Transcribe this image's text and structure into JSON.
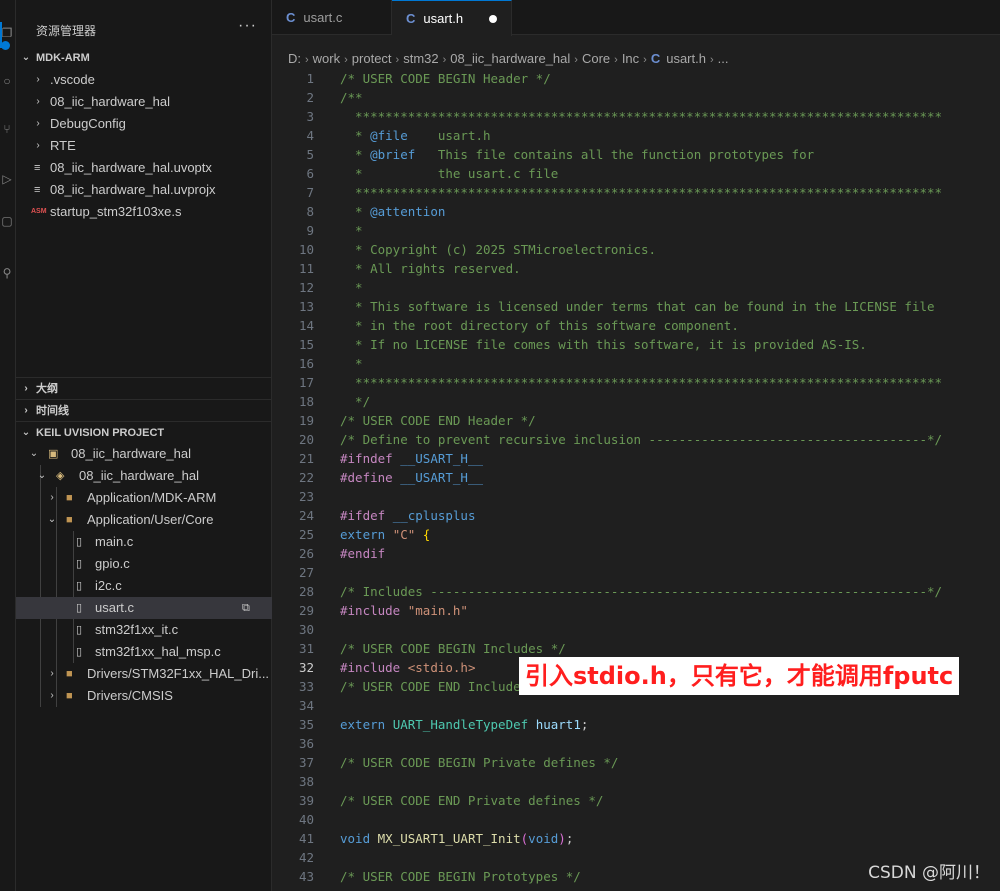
{
  "sidebar": {
    "title": "资源管理器",
    "more": "···",
    "mdk_section": "MDK-ARM",
    "mdk_items": [
      {
        "label": ".vscode",
        "kind": "folder"
      },
      {
        "label": "08_iic_hardware_hal",
        "kind": "folder"
      },
      {
        "label": "DebugConfig",
        "kind": "folder"
      },
      {
        "label": "RTE",
        "kind": "folder"
      },
      {
        "label": "08_iic_hardware_hal.uvoptx",
        "kind": "file"
      },
      {
        "label": "08_iic_hardware_hal.uvprojx",
        "kind": "file"
      },
      {
        "label": "startup_stm32f103xe.s",
        "kind": "asm"
      }
    ],
    "outline_section": "大纲",
    "timeline_section": "时间线",
    "keil_section": "KEIL UVISION PROJECT",
    "keil_items": [
      {
        "label": "08_iic_hardware_hal"
      },
      {
        "label": "08_iic_hardware_hal"
      },
      {
        "label": "Application/MDK-ARM"
      },
      {
        "label": "Application/User/Core"
      },
      {
        "label": "main.c"
      },
      {
        "label": "gpio.c"
      },
      {
        "label": "i2c.c"
      },
      {
        "label": "usart.c"
      },
      {
        "label": "stm32f1xx_it.c"
      },
      {
        "label": "stm32f1xx_hal_msp.c"
      },
      {
        "label": "Drivers/STM32F1xx_HAL_Dri..."
      },
      {
        "label": "Drivers/CMSIS"
      }
    ]
  },
  "tabs": [
    {
      "icon": "C",
      "label": "usart.c"
    },
    {
      "icon": "C",
      "label": "usart.h"
    }
  ],
  "breadcrumb": {
    "parts": [
      "D:",
      "work",
      "protect",
      "stm32",
      "08_iic_hardware_hal",
      "Core",
      "Inc"
    ],
    "file_icon": "C",
    "file": "usart.h",
    "tail": "..."
  },
  "editor": {
    "current_line": 32,
    "lines": [
      {
        "n": "1",
        "tokens": [
          [
            "cm",
            "/* USER CODE BEGIN Header */"
          ]
        ]
      },
      {
        "n": "2",
        "tokens": [
          [
            "cm",
            "/**"
          ]
        ]
      },
      {
        "n": "3",
        "tokens": [
          [
            "cm",
            "  ******************************************************************************"
          ]
        ]
      },
      {
        "n": "4",
        "tokens": [
          [
            "cm",
            "  * "
          ],
          [
            "doc",
            "@file"
          ],
          [
            "cm",
            "    usart.h"
          ]
        ]
      },
      {
        "n": "5",
        "tokens": [
          [
            "cm",
            "  * "
          ],
          [
            "doc",
            "@brief"
          ],
          [
            "cm",
            "   This file contains all the function prototypes for"
          ]
        ]
      },
      {
        "n": "6",
        "tokens": [
          [
            "cm",
            "  *          the usart.c file"
          ]
        ]
      },
      {
        "n": "7",
        "tokens": [
          [
            "cm",
            "  ******************************************************************************"
          ]
        ]
      },
      {
        "n": "8",
        "tokens": [
          [
            "cm",
            "  * "
          ],
          [
            "doc",
            "@attention"
          ]
        ]
      },
      {
        "n": "9",
        "tokens": [
          [
            "cm",
            "  *"
          ]
        ]
      },
      {
        "n": "10",
        "tokens": [
          [
            "cm",
            "  * Copyright (c) 2025 STMicroelectronics."
          ]
        ]
      },
      {
        "n": "11",
        "tokens": [
          [
            "cm",
            "  * All rights reserved."
          ]
        ]
      },
      {
        "n": "12",
        "tokens": [
          [
            "cm",
            "  *"
          ]
        ]
      },
      {
        "n": "13",
        "tokens": [
          [
            "cm",
            "  * This software is licensed under terms that can be found in the LICENSE file"
          ]
        ]
      },
      {
        "n": "14",
        "tokens": [
          [
            "cm",
            "  * in the root directory of this software component."
          ]
        ]
      },
      {
        "n": "15",
        "tokens": [
          [
            "cm",
            "  * If no LICENSE file comes with this software, it is provided AS-IS."
          ]
        ]
      },
      {
        "n": "16",
        "tokens": [
          [
            "cm",
            "  *"
          ]
        ]
      },
      {
        "n": "17",
        "tokens": [
          [
            "cm",
            "  ******************************************************************************"
          ]
        ]
      },
      {
        "n": "18",
        "tokens": [
          [
            "cm",
            "  */"
          ]
        ]
      },
      {
        "n": "19",
        "tokens": [
          [
            "cm",
            "/* USER CODE END Header */"
          ]
        ]
      },
      {
        "n": "20",
        "tokens": [
          [
            "cm",
            "/* Define to prevent recursive inclusion -------------------------------------*/"
          ]
        ]
      },
      {
        "n": "21",
        "tokens": [
          [
            "kw",
            "#ifndef"
          ],
          [
            "pl",
            " "
          ],
          [
            "kb",
            "__USART_H__"
          ]
        ]
      },
      {
        "n": "22",
        "tokens": [
          [
            "kw",
            "#define"
          ],
          [
            "pl",
            " "
          ],
          [
            "kb",
            "__USART_H__"
          ]
        ]
      },
      {
        "n": "23",
        "tokens": []
      },
      {
        "n": "24",
        "tokens": [
          [
            "kw",
            "#ifdef"
          ],
          [
            "pl",
            " "
          ],
          [
            "kb",
            "__cplusplus"
          ]
        ]
      },
      {
        "n": "25",
        "tokens": [
          [
            "kb",
            "extern"
          ],
          [
            "pl",
            " "
          ],
          [
            "st",
            "\"C\""
          ],
          [
            "pl",
            " "
          ],
          [
            "br2",
            "{"
          ]
        ]
      },
      {
        "n": "26",
        "tokens": [
          [
            "kw",
            "#endif"
          ]
        ]
      },
      {
        "n": "27",
        "tokens": []
      },
      {
        "n": "28",
        "tokens": [
          [
            "cm",
            "/* Includes ------------------------------------------------------------------*/"
          ]
        ]
      },
      {
        "n": "29",
        "tokens": [
          [
            "kw",
            "#include"
          ],
          [
            "pl",
            " "
          ],
          [
            "st",
            "\"main.h\""
          ]
        ]
      },
      {
        "n": "30",
        "tokens": []
      },
      {
        "n": "31",
        "tokens": [
          [
            "cm",
            "/* USER CODE BEGIN Includes */"
          ]
        ]
      },
      {
        "n": "32",
        "tokens": [
          [
            "kw",
            "#include"
          ],
          [
            "pl",
            " "
          ],
          [
            "st",
            "<stdio.h>"
          ]
        ]
      },
      {
        "n": "33",
        "tokens": [
          [
            "cm",
            "/* USER CODE END Includes */"
          ]
        ]
      },
      {
        "n": "34",
        "tokens": []
      },
      {
        "n": "35",
        "tokens": [
          [
            "kb",
            "extern"
          ],
          [
            "pl",
            " "
          ],
          [
            "ty",
            "UART_HandleTypeDef"
          ],
          [
            "pl",
            " "
          ],
          [
            "id",
            "huart1"
          ],
          [
            "pl",
            ";"
          ]
        ]
      },
      {
        "n": "36",
        "tokens": []
      },
      {
        "n": "37",
        "tokens": [
          [
            "cm",
            "/* USER CODE BEGIN Private defines */"
          ]
        ]
      },
      {
        "n": "38",
        "tokens": []
      },
      {
        "n": "39",
        "tokens": [
          [
            "cm",
            "/* USER CODE END Private defines */"
          ]
        ]
      },
      {
        "n": "40",
        "tokens": []
      },
      {
        "n": "41",
        "tokens": [
          [
            "kb",
            "void"
          ],
          [
            "pl",
            " "
          ],
          [
            "fn",
            "MX_USART1_UART_Init"
          ],
          [
            "br",
            "("
          ],
          [
            "kb",
            "void"
          ],
          [
            "br",
            ")"
          ],
          [
            "pl",
            ";"
          ]
        ]
      },
      {
        "n": "42",
        "tokens": []
      },
      {
        "n": "43",
        "tokens": [
          [
            "cm",
            "/* USER CODE BEGIN Prototypes */"
          ]
        ]
      }
    ]
  },
  "annotation": "引入stdio.h，只有它，才能调用fputc",
  "watermark": "CSDN @阿川！",
  "colors": {
    "accent": "#0078d4",
    "annotation_text": "#ff1e1e",
    "annotation_bg": "#ffffff"
  }
}
